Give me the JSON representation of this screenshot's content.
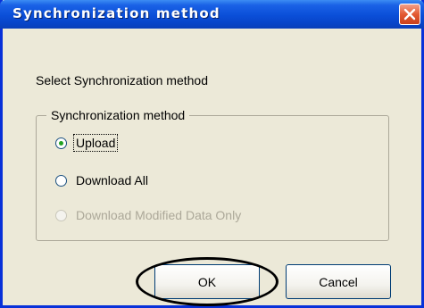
{
  "dialog": {
    "title": "Synchronization method",
    "close_icon": "close-icon",
    "prompt": "Select Synchronization method",
    "group_label": "Synchronization method",
    "options": [
      {
        "label": "Upload",
        "checked": true,
        "enabled": true
      },
      {
        "label": "Download All",
        "checked": false,
        "enabled": true
      },
      {
        "label": "Download Modified Data Only",
        "checked": false,
        "enabled": false
      }
    ],
    "ok_label": "OK",
    "cancel_label": "Cancel"
  },
  "colors": {
    "title_bar": "#0a4ed8",
    "dialog_bg": "#ece9d8",
    "close_button": "#e35a32",
    "radio_dot": "#21a121",
    "disabled_text": "#aca899"
  }
}
